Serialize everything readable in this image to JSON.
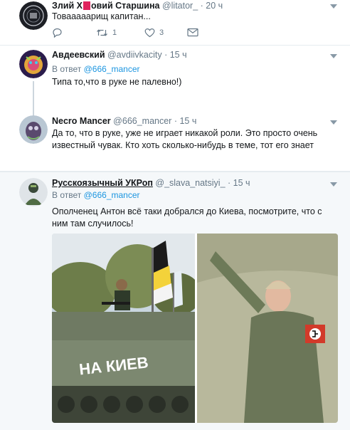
{
  "tweets": [
    {
      "name_a": "Злий Х",
      "name_b": "овий Старшина",
      "handle": "@litator_",
      "time": "· 20 ч",
      "text": "Товааааарищ капитан...",
      "retweets": "1",
      "likes": "3"
    },
    {
      "name": "Авдеевский",
      "handle": "@avdiivkacity",
      "time": "· 15 ч",
      "reply_prefix": "В ответ",
      "reply_to": "@666_mancer",
      "text": "Типа то,что в руке не палевно!)"
    },
    {
      "name": "Necro Mancer",
      "handle": "@666_mancer",
      "time": "· 15 ч",
      "text": "Да то, что в руке, уже не играет никакой роли. Это просто очень известный чувак. Кто хоть сколько-нибудь в теме, тот его знает"
    },
    {
      "name": "Русскоязычный УКРоп",
      "handle": "@_slava_natsiyi_",
      "time": "· 15 ч",
      "reply_prefix": "В ответ",
      "reply_to": "@666_mancer",
      "text": "Ополченец Антон всё таки добрался до Киева, посмотрите, что с ним там случилось!",
      "photo_caption": "НА КИЕВ"
    }
  ],
  "icons": [
    "reply-icon",
    "retweet-icon",
    "like-icon",
    "dm-icon",
    "caret-down-icon"
  ],
  "colors": {
    "link": "#1b95e0",
    "muted": "#657786",
    "divider": "#e6ecf0",
    "redaction": "#e0245e"
  }
}
